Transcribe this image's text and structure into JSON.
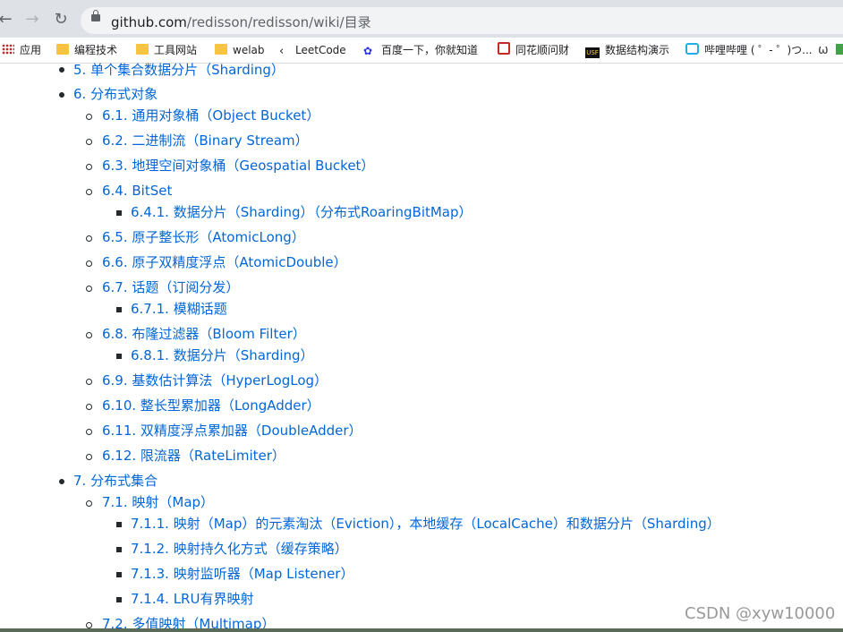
{
  "browser": {
    "url_host": "github.com",
    "url_path": "/redisson/redisson/wiki/目录"
  },
  "bookmarks": [
    {
      "label": "应用",
      "icon": "apps-grid-icon"
    },
    {
      "label": "编程技术",
      "icon": "folder-icon"
    },
    {
      "label": "工具网站",
      "icon": "folder-icon"
    },
    {
      "label": "welab",
      "icon": "folder-icon"
    },
    {
      "label": "LeetCode",
      "icon": "leetcode-icon"
    },
    {
      "label": "百度一下，你就知道",
      "icon": "baidu-icon"
    },
    {
      "label": "同花顺问财",
      "icon": "tonghuashun-icon"
    },
    {
      "label": "数据结构演示",
      "icon": "usfca-icon"
    },
    {
      "label": "哔哩哔哩 ( ゜- ゜)つ...",
      "icon": "bilibili-icon"
    }
  ],
  "toc": [
    {
      "text": "5. 单个集合数据分片（Sharding）",
      "level": 1
    },
    {
      "text": "6. 分布式对象",
      "level": 1
    },
    {
      "text": "6.1. 通用对象桶（Object Bucket）",
      "level": 2
    },
    {
      "text": "6.2. 二进制流（Binary Stream）",
      "level": 2
    },
    {
      "text": "6.3. 地理空间对象桶（Geospatial Bucket）",
      "level": 2
    },
    {
      "text": "6.4. BitSet",
      "level": 2
    },
    {
      "text": "6.4.1. 数据分片（Sharding）（分布式RoaringBitMap）",
      "level": 3
    },
    {
      "text": "6.5. 原子整长形（AtomicLong）",
      "level": 2
    },
    {
      "text": "6.6. 原子双精度浮点（AtomicDouble）",
      "level": 2
    },
    {
      "text": "6.7. 话题（订阅分发）",
      "level": 2
    },
    {
      "text": "6.7.1. 模糊话题",
      "level": 3
    },
    {
      "text": "6.8. 布隆过滤器（Bloom Filter）",
      "level": 2
    },
    {
      "text": "6.8.1. 数据分片（Sharding）",
      "level": 3
    },
    {
      "text": "6.9. 基数估计算法（HyperLogLog）",
      "level": 2
    },
    {
      "text": "6.10. 整长型累加器（LongAdder）",
      "level": 2
    },
    {
      "text": "6.11. 双精度浮点累加器（DoubleAdder）",
      "level": 2
    },
    {
      "text": "6.12. 限流器（RateLimiter）",
      "level": 2
    },
    {
      "text": "7. 分布式集合",
      "level": 1
    },
    {
      "text": "7.1. 映射（Map）",
      "level": 2
    },
    {
      "text": "7.1.1. 映射（Map）的元素淘汰（Eviction），本地缓存（LocalCache）和数据分片（Sharding）",
      "level": 3
    },
    {
      "text": "7.1.2. 映射持久化方式（缓存策略）",
      "level": 3
    },
    {
      "text": "7.1.3. 映射监听器（Map Listener）",
      "level": 3
    },
    {
      "text": "7.1.4. LRU有界映射",
      "level": 3
    },
    {
      "text": "7.2. 多值映射（Multimap）",
      "level": 2
    }
  ],
  "watermark": "CSDN @xyw10000"
}
